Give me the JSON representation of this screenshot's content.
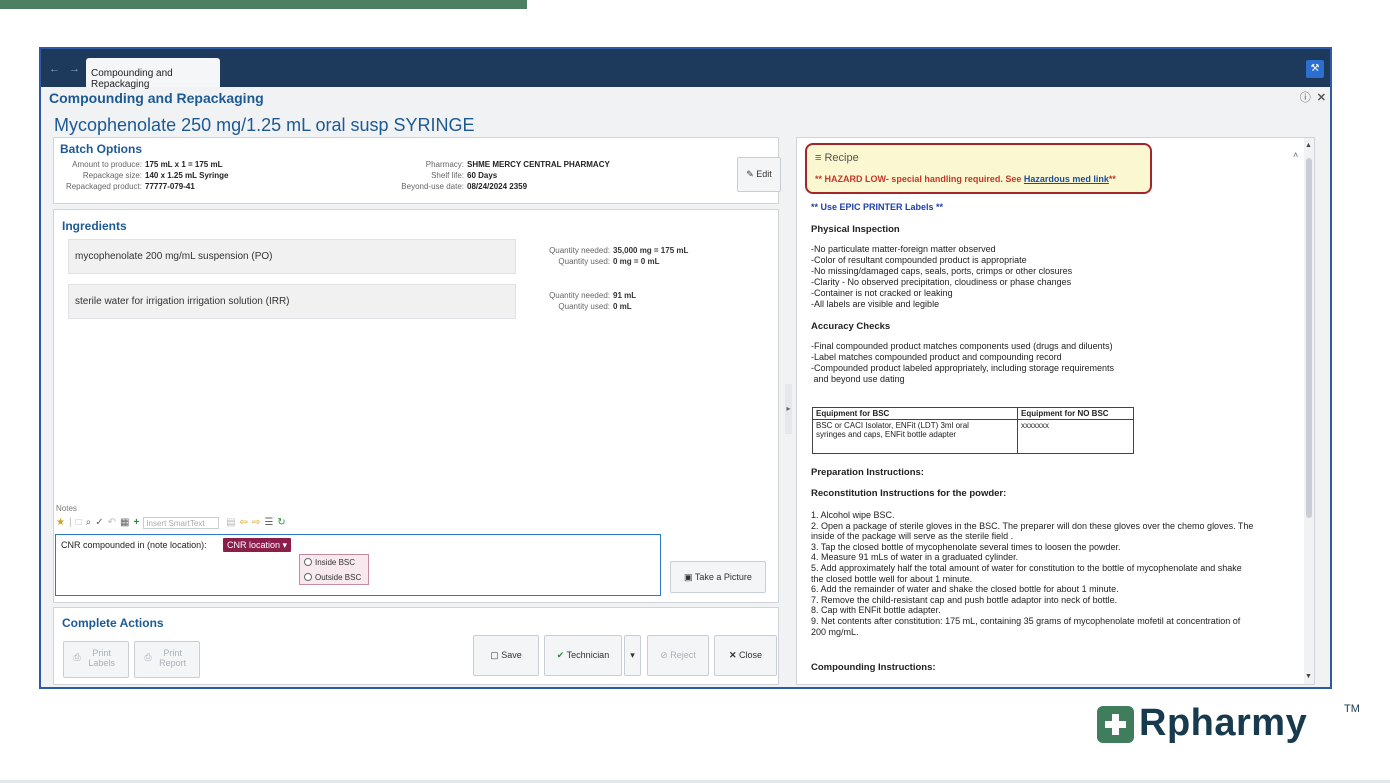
{
  "window": {
    "tab_label": "Compounding and Repackaging",
    "nav_arrows": "← →",
    "module_title": "Compounding and Repackaging",
    "medication_title": "Mycophenolate 250 mg/1.25 mL oral susp SYRINGE"
  },
  "batch": {
    "header": "Batch Options",
    "amount_label": "Amount to produce:",
    "amount_value": "175 mL x 1 = 175 mL",
    "repackage_label": "Repackage size:",
    "repackage_value": "140 x 1.25 mL Syringe",
    "product_label": "Repackaged product:",
    "product_value": "77777-079-41",
    "pharmacy_label": "Pharmacy:",
    "pharmacy_value": "SHME MERCY CENTRAL PHARMACY",
    "shelf_label": "Shelf life:",
    "shelf_value": "60 Days",
    "bud_label": "Beyond-use date:",
    "bud_value": "08/24/2024 2359",
    "edit_label": "Edit"
  },
  "ingredients": {
    "header": "Ingredients",
    "qty_needed_label": "Quantity needed:",
    "qty_used_label": "Quantity used:",
    "items": [
      {
        "name": "mycophenolate 200 mg/mL suspension (PO)",
        "needed": "35,000 mg  =  175 mL",
        "used": "0 mg  =  0 mL"
      },
      {
        "name": "sterile water for irrigation irrigation solution (IRR)",
        "needed": "91 mL",
        "used": "0 mL"
      }
    ]
  },
  "notes": {
    "label": "Notes",
    "smarttext_placeholder": "Insert SmartText",
    "note_text": "CNR compounded in (note location):",
    "tag_label": "CNR location",
    "options": [
      "Inside BSC",
      "Outside BSC"
    ],
    "take_picture_label": "Take a Picture"
  },
  "actions": {
    "header": "Complete Actions",
    "print_labels": "Print Labels",
    "print_report": "Print Report",
    "save": "Save",
    "technician": "Technician",
    "reject": "Reject",
    "close": "Close"
  },
  "recipe": {
    "header": "Recipe",
    "hazard_text": "** HAZARD LOW- special handling required. See",
    "hazard_link": "Hazardous med link",
    "hazard_tail": "**",
    "printer_note": "**  Use EPIC PRINTER Labels  **",
    "physical_header": "Physical Inspection",
    "physical_items": [
      "-No particulate matter-foreign matter observed",
      "-Color of resultant compounded product is appropriate",
      "-No missing/damaged caps, seals, ports, crimps or other closures",
      "-Clarity - No observed precipitation, cloudiness or phase changes",
      "-Container is not cracked or leaking",
      "-All labels are visible and legible"
    ],
    "accuracy_header": "Accuracy Checks",
    "accuracy_items": [
      "-Final compounded product matches components used (drugs and diluents)",
      "-Label matches compounded product and compounding record",
      "-Compounded product labeled appropriately, including storage requirements",
      " and beyond use dating"
    ],
    "equip_col1": "Equipment for BSC",
    "equip_col2": "Equipment for NO BSC",
    "equip_val1_line1": "BSC or CACI Isolator, ENFit (LDT) 3ml oral",
    "equip_val1_line2": "syringes and caps, ENFit bottle adapter",
    "equip_val2": "xxxxxxx",
    "prep_header": "Preparation Instructions:",
    "recon_header": "Reconstitution Instructions for the powder:",
    "recon_items": [
      "1.  Alcohol wipe BSC.",
      "2.  Open a package of sterile gloves in the BSC. The preparer will don these gloves over the chemo gloves. The",
      "inside of the package will serve as the sterile field .",
      "3.  Tap the closed bottle of mycophenolate several times to loosen the powder.",
      "4.  Measure 91 mLs of water in a graduated cylinder.",
      "5.  Add approximately half the total amount of water for constitution to the bottle of mycophenolate and shake",
      "the closed bottle well for about 1 minute.",
      "6.  Add the remainder of water and shake the closed bottle for about 1 minute.",
      "7.  Remove the child-resistant cap and push bottle adaptor into neck of bottle.",
      "8.  Cap with ENFit bottle adapter.",
      "9.  Net contents after constitution: 175 mL, containing 35 grams of mycophenolate mofetil at concentration of",
      "200 mg/mL."
    ],
    "compounding_header": "Compounding Instructions:"
  },
  "brand": {
    "name": "Rpharmy",
    "tm": "TM"
  }
}
